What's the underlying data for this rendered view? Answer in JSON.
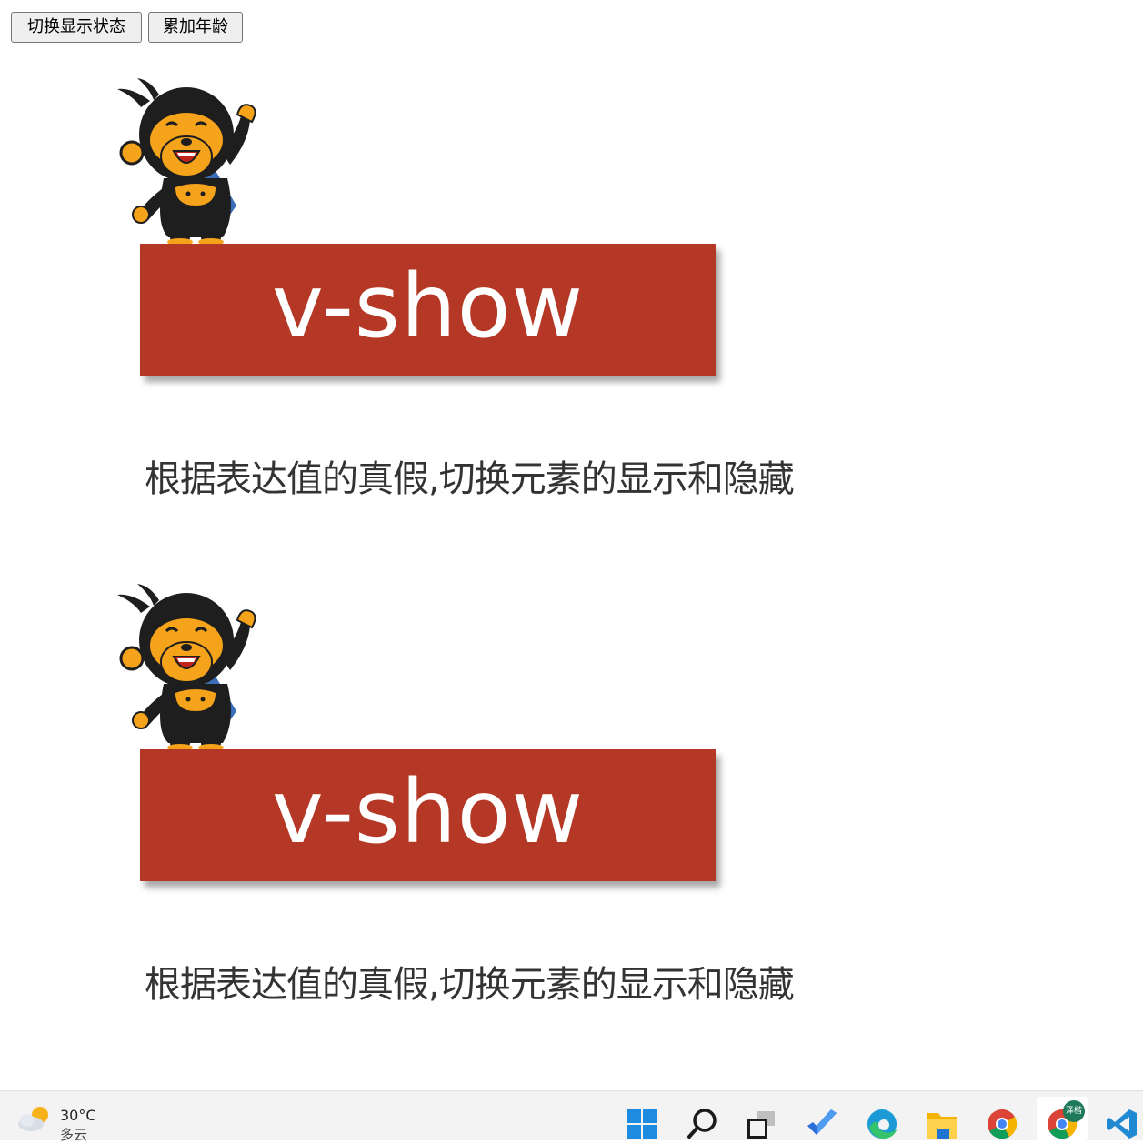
{
  "toolbar": {
    "toggle_label": "切换显示状态",
    "age_label": "累加年龄"
  },
  "blocks": [
    {
      "banner": "v-show",
      "caption": "根据表达值的真假,切换元素的显示和隐藏"
    },
    {
      "banner": "v-show",
      "caption": "根据表达值的真假,切换元素的显示和隐藏"
    }
  ],
  "taskbar": {
    "weather_temp": "30°C",
    "weather_desc": "多云",
    "badge_text": "泽楷",
    "icons": [
      "start-icon",
      "search-icon",
      "task-view-icon",
      "todo-icon",
      "edge-icon",
      "file-explorer-icon",
      "chrome-icon",
      "chrome-profile-icon",
      "vscode-icon"
    ]
  },
  "colors": {
    "banner": "#b53826",
    "mascot_fur": "#1e1e1e",
    "mascot_face": "#f5a31a"
  }
}
